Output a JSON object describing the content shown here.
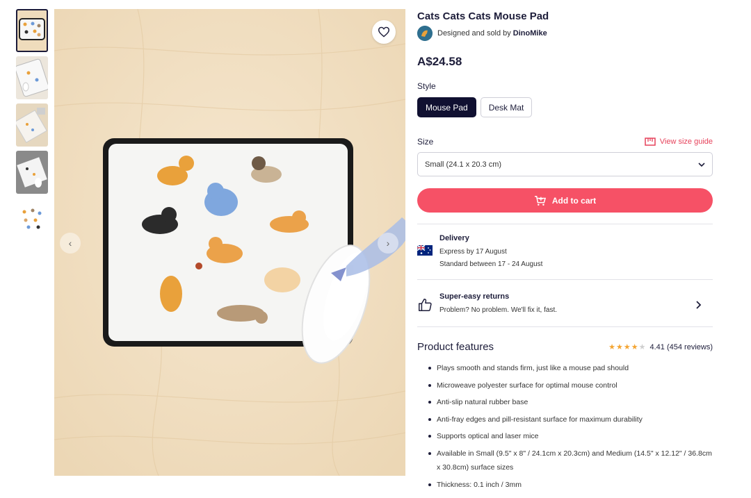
{
  "product": {
    "title": "Cats Cats Cats Mouse Pad",
    "seller_prefix": "Designed and sold by",
    "seller_name": "DinoMike",
    "price": "A$24.58"
  },
  "style": {
    "label": "Style",
    "options": [
      "Mouse Pad",
      "Desk Mat"
    ],
    "selected": "Mouse Pad"
  },
  "size": {
    "label": "Size",
    "guide_link": "View size guide",
    "selected": "Small (24.1 x 20.3 cm)"
  },
  "cart": {
    "label": "Add to cart"
  },
  "delivery": {
    "title": "Delivery",
    "express": "Express by 17 August",
    "standard": "Standard between 17 - 24 August"
  },
  "returns": {
    "title": "Super-easy returns",
    "subtitle": "Problem? No problem. We'll fix it, fast."
  },
  "features": {
    "title": "Product features",
    "rating": "4.41 (454 reviews)",
    "rating_stars": 4.41,
    "items": [
      "Plays smooth and stands firm, just like a mouse pad should",
      "Microweave polyester surface for optimal mouse control",
      "Anti-slip natural rubber base",
      "Anti-fray edges and pill-resistant surface for maximum durability",
      "Supports optical and laser mice",
      "Available in Small (9.5\" x 8\" / 24.1cm x 20.3cm) and Medium (14.5\" x 12.12\" / 36.8cm x 30.8cm) surface sizes",
      "Thickness: 0.1 inch / 3mm"
    ]
  },
  "colors": {
    "brand_dark": "#101031",
    "accent": "#f65166",
    "star": "#f4a533"
  },
  "icons": [
    "heart-icon",
    "chevron-left-icon",
    "chevron-right-icon",
    "ruler-icon",
    "chevron-down-icon",
    "cart-icon",
    "flag-au-icon",
    "thumbs-up-icon"
  ]
}
